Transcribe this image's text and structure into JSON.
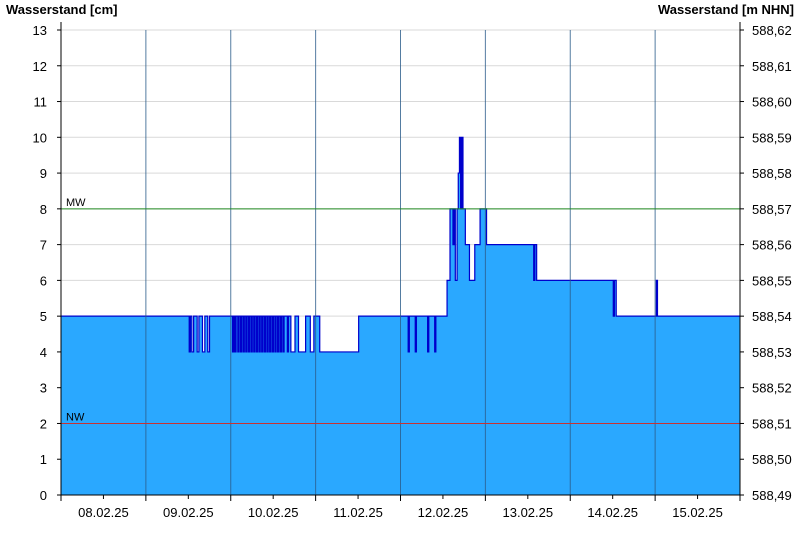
{
  "chart_data": {
    "type": "area",
    "y_left_title": "Wasserstand [cm]",
    "y_right_title": "Wasserstand [m NHN]",
    "ylim": [
      0,
      13
    ],
    "y_right_lim": [
      588.49,
      588.62
    ],
    "y_left_ticks": [
      "0",
      "1",
      "2",
      "3",
      "4",
      "5",
      "6",
      "7",
      "8",
      "9",
      "10",
      "11",
      "12",
      "13"
    ],
    "y_right_ticks": [
      "588,49",
      "588,50",
      "588,51",
      "588,52",
      "588,53",
      "588,54",
      "588,55",
      "588,56",
      "588,57",
      "588,58",
      "588,59",
      "588,60",
      "588,61",
      "588,62"
    ],
    "x_ticks": [
      "08.02.25",
      "09.02.25",
      "10.02.25",
      "11.02.25",
      "12.02.25",
      "13.02.25",
      "14.02.25",
      "15.02.25"
    ],
    "grid": true,
    "reference_lines": [
      {
        "label": "MW",
        "value": 8,
        "color": "#228b22"
      },
      {
        "label": "NW",
        "value": 2,
        "color": "#c83232"
      }
    ],
    "fill_color": "#2aa8ff",
    "line_color": "#0000cc",
    "series": [
      {
        "points": [
          [
            "07.02.25 12:00",
            5
          ],
          [
            "09.02.25 00:00",
            5
          ],
          [
            "09.02.25 00:15",
            4
          ],
          [
            "09.02.25 00:35",
            5
          ],
          [
            "09.02.25 01:00",
            4
          ],
          [
            "09.02.25 01:30",
            5
          ],
          [
            "09.02.25 02:30",
            4
          ],
          [
            "09.02.25 03:00",
            5
          ],
          [
            "09.02.25 04:00",
            4
          ],
          [
            "09.02.25 04:40",
            5
          ],
          [
            "09.02.25 05:30",
            4
          ],
          [
            "09.02.25 06:00",
            5
          ],
          [
            "09.02.25 12:30",
            4
          ],
          [
            "09.02.25 12:50",
            5
          ],
          [
            "09.02.25 13:10",
            4
          ],
          [
            "09.02.25 13:30",
            5
          ],
          [
            "09.02.25 14:00",
            4
          ],
          [
            "09.02.25 14:20",
            5
          ],
          [
            "09.02.25 14:45",
            4
          ],
          [
            "09.02.25 15:05",
            5
          ],
          [
            "09.02.25 15:30",
            4
          ],
          [
            "09.02.25 15:50",
            5
          ],
          [
            "09.02.25 16:15",
            4
          ],
          [
            "09.02.25 16:35",
            5
          ],
          [
            "09.02.25 17:00",
            4
          ],
          [
            "09.02.25 17:20",
            5
          ],
          [
            "09.02.25 17:45",
            4
          ],
          [
            "09.02.25 18:05",
            5
          ],
          [
            "09.02.25 18:30",
            4
          ],
          [
            "09.02.25 18:50",
            5
          ],
          [
            "09.02.25 19:15",
            4
          ],
          [
            "09.02.25 19:35",
            5
          ],
          [
            "09.02.25 20:00",
            4
          ],
          [
            "09.02.25 20:20",
            5
          ],
          [
            "09.02.25 20:45",
            4
          ],
          [
            "09.02.25 21:05",
            5
          ],
          [
            "09.02.25 21:30",
            4
          ],
          [
            "09.02.25 21:50",
            5
          ],
          [
            "09.02.25 22:15",
            4
          ],
          [
            "09.02.25 22:35",
            5
          ],
          [
            "09.02.25 23:00",
            4
          ],
          [
            "09.02.25 23:20",
            5
          ],
          [
            "09.02.25 23:45",
            4
          ],
          [
            "10.02.25 00:05",
            5
          ],
          [
            "10.02.25 00:30",
            4
          ],
          [
            "10.02.25 00:50",
            5
          ],
          [
            "10.02.25 01:15",
            4
          ],
          [
            "10.02.25 01:35",
            5
          ],
          [
            "10.02.25 02:00",
            4
          ],
          [
            "10.02.25 02:20",
            5
          ],
          [
            "10.02.25 02:45",
            4
          ],
          [
            "10.02.25 03:05",
            5
          ],
          [
            "10.02.25 04:00",
            4
          ],
          [
            "10.02.25 04:20",
            5
          ],
          [
            "10.02.25 05:00",
            4
          ],
          [
            "10.02.25 06:00",
            4
          ],
          [
            "10.02.25 06:10",
            5
          ],
          [
            "10.02.25 07:00",
            5
          ],
          [
            "10.02.25 07:10",
            4
          ],
          [
            "10.02.25 09:00",
            4
          ],
          [
            "10.02.25 09:10",
            5
          ],
          [
            "10.02.25 10:20",
            5
          ],
          [
            "10.02.25 10:30",
            4
          ],
          [
            "10.02.25 11:20",
            4
          ],
          [
            "10.02.25 11:30",
            5
          ],
          [
            "10.02.25 13:00",
            5
          ],
          [
            "10.02.25 13:10",
            4
          ],
          [
            "11.02.25 00:00",
            4
          ],
          [
            "11.02.25 00:10",
            5
          ],
          [
            "11.02.25 14:00",
            5
          ],
          [
            "11.02.25 14:10",
            4
          ],
          [
            "11.02.25 14:30",
            5
          ],
          [
            "11.02.25 16:00",
            5
          ],
          [
            "11.02.25 16:10",
            4
          ],
          [
            "11.02.25 16:30",
            5
          ],
          [
            "11.02.25 19:30",
            5
          ],
          [
            "11.02.25 19:40",
            4
          ],
          [
            "11.02.25 20:00",
            5
          ],
          [
            "11.02.25 21:30",
            5
          ],
          [
            "11.02.25 21:40",
            4
          ],
          [
            "11.02.25 22:00",
            5
          ],
          [
            "12.02.25 01:00",
            5
          ],
          [
            "12.02.25 01:10",
            6
          ],
          [
            "12.02.25 01:50",
            6
          ],
          [
            "12.02.25 02:00",
            8
          ],
          [
            "12.02.25 02:40",
            8
          ],
          [
            "12.02.25 02:50",
            7
          ],
          [
            "12.02.25 03:10",
            8
          ],
          [
            "12.02.25 03:30",
            6
          ],
          [
            "12.02.25 04:00",
            8
          ],
          [
            "12.02.25 04:20",
            9
          ],
          [
            "12.02.25 04:40",
            10
          ],
          [
            "12.02.25 05:00",
            8
          ],
          [
            "12.02.25 05:20",
            10
          ],
          [
            "12.02.25 05:40",
            8
          ],
          [
            "12.02.25 06:20",
            7
          ],
          [
            "12.02.25 07:20",
            7
          ],
          [
            "12.02.25 07:30",
            6
          ],
          [
            "12.02.25 08:30",
            6
          ],
          [
            "12.02.25 09:00",
            7
          ],
          [
            "12.02.25 10:20",
            7
          ],
          [
            "12.02.25 10:30",
            8
          ],
          [
            "12.02.25 12:00",
            8
          ],
          [
            "12.02.25 12:20",
            7
          ],
          [
            "13.02.25 00:00",
            7
          ],
          [
            "13.02.25 01:30",
            7
          ],
          [
            "13.02.25 01:40",
            6
          ],
          [
            "13.02.25 02:00",
            7
          ],
          [
            "13.02.25 02:30",
            6
          ],
          [
            "14.02.25 00:00",
            6
          ],
          [
            "14.02.25 00:10",
            5
          ],
          [
            "14.02.25 00:30",
            6
          ],
          [
            "14.02.25 01:00",
            5
          ],
          [
            "14.02.25 12:00",
            5
          ],
          [
            "14.02.25 12:20",
            6
          ],
          [
            "14.02.25 12:40",
            5
          ],
          [
            "15.02.25 12:00",
            5
          ]
        ]
      }
    ]
  }
}
